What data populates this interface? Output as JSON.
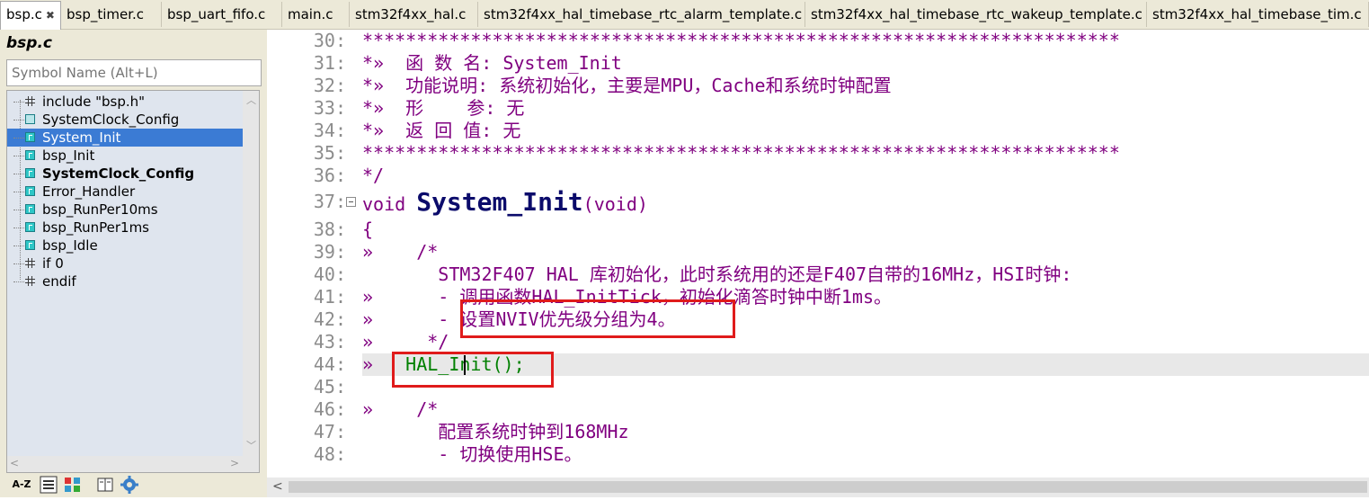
{
  "tabs": [
    {
      "label": "bsp.c",
      "active": true
    },
    {
      "label": "bsp_timer.c"
    },
    {
      "label": "bsp_uart_fifo.c"
    },
    {
      "label": "main.c"
    },
    {
      "label": "stm32f4xx_hal.c"
    },
    {
      "label": "stm32f4xx_hal_timebase_rtc_alarm_template.c"
    },
    {
      "label": "stm32f4xx_hal_timebase_rtc_wakeup_template.c"
    },
    {
      "label": "stm32f4xx_hal_timebase_tim.c"
    }
  ],
  "tab_close_glyph": "✖",
  "symbol_panel": {
    "title": "bsp.c",
    "search_placeholder": "Symbol Name (Alt+L)",
    "items": [
      {
        "label": "include \"bsp.h\"",
        "icon": "include-icon"
      },
      {
        "label": "SystemClock_Config",
        "icon": "prototype-icon"
      },
      {
        "label": "System_Init",
        "icon": "function-icon",
        "selected": true
      },
      {
        "label": "bsp_Init",
        "icon": "function-icon"
      },
      {
        "label": "SystemClock_Config",
        "icon": "function-icon",
        "bold": true
      },
      {
        "label": "Error_Handler",
        "icon": "function-icon"
      },
      {
        "label": "bsp_RunPer10ms",
        "icon": "function-icon"
      },
      {
        "label": "bsp_RunPer1ms",
        "icon": "function-icon"
      },
      {
        "label": "bsp_Idle",
        "icon": "function-icon"
      },
      {
        "label": "if 0",
        "icon": "include-icon"
      },
      {
        "label": "endif",
        "icon": "include-icon"
      }
    ],
    "toolbar": {
      "sort_az": "A-Z"
    }
  },
  "editor": {
    "lines": [
      {
        "num": "30:",
        "text": "**********************************************************************"
      },
      {
        "num": "31:",
        "text": "*»  函 数 名: System_Init"
      },
      {
        "num": "32:",
        "text": "*»  功能说明: 系统初始化，主要是MPU，Cache和系统时钟配置"
      },
      {
        "num": "33:",
        "text": "*»  形    参: 无"
      },
      {
        "num": "34:",
        "text": "*»  返 回 值: 无"
      },
      {
        "num": "35:",
        "text": "**********************************************************************"
      },
      {
        "num": "36:",
        "text": "*/"
      },
      {
        "num": "37:",
        "text": "void System_Init(void)"
      },
      {
        "num": "38:",
        "text": "{"
      },
      {
        "num": "39:",
        "text": "»    /*"
      },
      {
        "num": "40:",
        "text": "       STM32F407 HAL 库初始化，此时系统用的还是F407自带的16MHz，HSI时钟:"
      },
      {
        "num": "41:",
        "text": "»      - 调用函数HAL_InitTick，初始化滴答时钟中断1ms。"
      },
      {
        "num": "42:",
        "text": "»      - 设置NVIV优先级分组为4。"
      },
      {
        "num": "43:",
        "text": "»     */"
      },
      {
        "num": "44:",
        "text": "»   HAL_Init();"
      },
      {
        "num": "45:",
        "text": ""
      },
      {
        "num": "46:",
        "text": "»    /*"
      },
      {
        "num": "47:",
        "text": "       配置系统时钟到168MHz"
      },
      {
        "num": "48:",
        "text": "       - 切换使用HSE。"
      }
    ],
    "line37": {
      "kw": "void ",
      "fn": "System_Init",
      "args": "(void)"
    },
    "line44": {
      "indent": "»   ",
      "call": "HAL_Init",
      "rest": "();"
    }
  },
  "colors": {
    "accent_select": "#3b7bd4",
    "highlight_box": "#e01b1b",
    "comment": "#800080"
  }
}
